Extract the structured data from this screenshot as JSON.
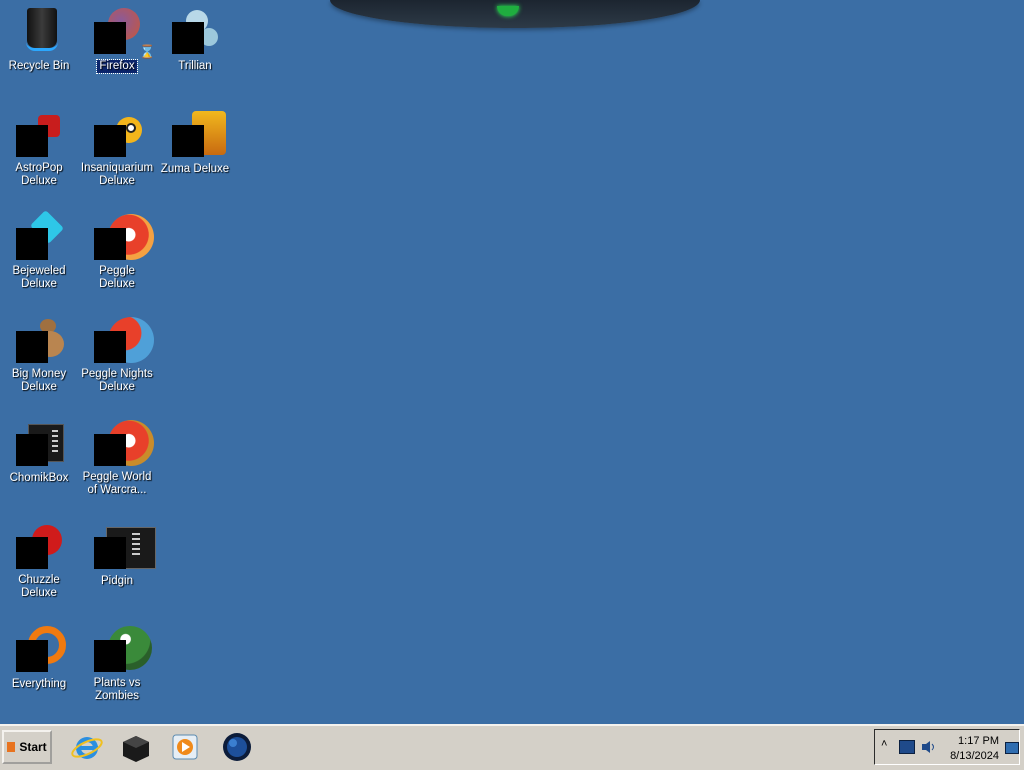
{
  "desktop": {
    "icons": [
      {
        "label": "Recycle Bin"
      },
      {
        "label": "Firefox",
        "selected": true
      },
      {
        "label": "Trillian"
      },
      {
        "label": "AstroPop Deluxe"
      },
      {
        "label": "Insaniquarium Deluxe"
      },
      {
        "label": "Zuma Deluxe"
      },
      {
        "label": "Bejeweled Deluxe"
      },
      {
        "label": "Peggle Deluxe"
      },
      {
        "label": "Big Money Deluxe"
      },
      {
        "label": "Peggle Nights Deluxe"
      },
      {
        "label": "ChomikBox"
      },
      {
        "label": "Peggle World of Warcra..."
      },
      {
        "label": "Chuzzle Deluxe"
      },
      {
        "label": "Pidgin"
      },
      {
        "label": "Everything"
      },
      {
        "label": "Plants vs Zombies"
      }
    ]
  },
  "taskbar": {
    "start_label": "Start",
    "quick_launch": [
      "internet-explorer-icon",
      "cube-app-icon",
      "media-player-icon",
      "globe-app-icon"
    ],
    "tray": {
      "time": "1:17 PM",
      "date": "8/13/2024",
      "icons": [
        "expand-chevron-icon",
        "network-icon",
        "volume-icon",
        "show-desktop-icon"
      ]
    }
  }
}
